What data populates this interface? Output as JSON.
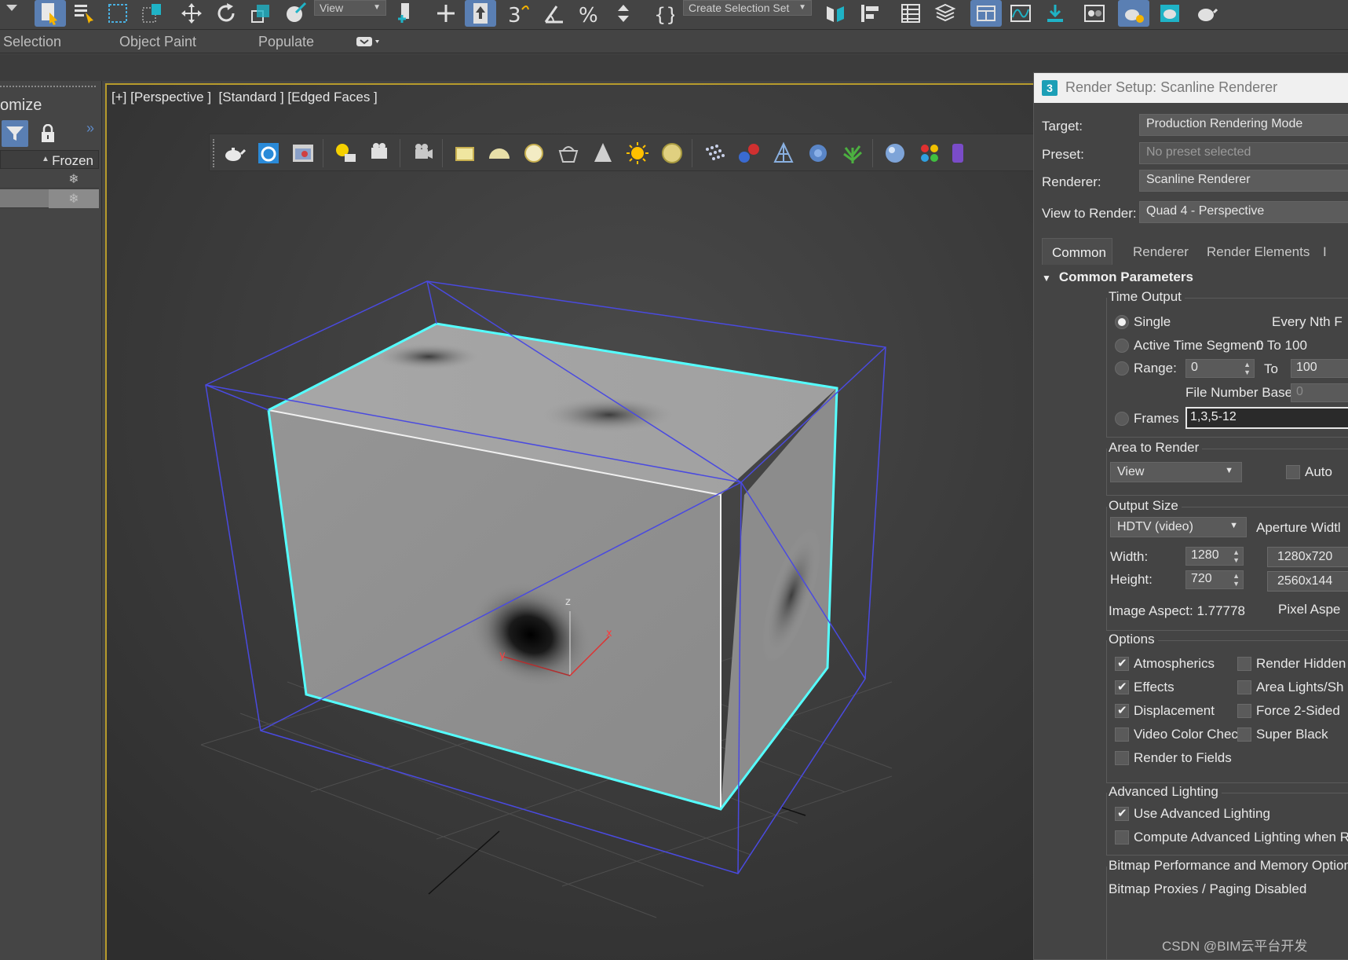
{
  "toolbar": {
    "view_dropdown": "View",
    "selection_set_dropdown": "Create Selection Set"
  },
  "ribbon": {
    "tabs": [
      "Selection",
      "Object Paint",
      "Populate"
    ]
  },
  "scene_explorer": {
    "title": "omize",
    "column_header": "Frozen"
  },
  "viewport": {
    "label": "[+] [Perspective ]  [Standard ] [Edged Faces ]",
    "gizmo": {
      "z": "z",
      "x": "x",
      "y": "y"
    }
  },
  "render_setup": {
    "title": "Render Setup: Scanline Renderer",
    "target_label": "Target:",
    "target_value": "Production Rendering Mode",
    "preset_label": "Preset:",
    "preset_value": "No preset selected",
    "renderer_label": "Renderer:",
    "renderer_value": "Scanline Renderer",
    "view_label": "View to Render:",
    "view_value": "Quad 4 - Perspective",
    "tabs": [
      "Common",
      "Renderer",
      "Render Elements",
      "I"
    ],
    "section": "Common Parameters",
    "time_output": {
      "title": "Time Output",
      "single": "Single",
      "every_nth": "Every Nth F",
      "active_segment": "Active Time Segment:",
      "active_segment_value": "0 To 100",
      "range": "Range:",
      "range_from": "0",
      "range_to_label": "To",
      "range_to": "100",
      "file_number_base": "File Number Base:",
      "file_number_base_value": "0",
      "frames": "Frames",
      "frames_value": "1,3,5-12"
    },
    "area_to_render": {
      "title": "Area to Render",
      "dropdown": "View",
      "auto": "Auto"
    },
    "output_size": {
      "title": "Output Size",
      "dropdown": "HDTV (video)",
      "aperture": "Aperture Widtl",
      "width_label": "Width:",
      "width_value": "1280",
      "height_label": "Height:",
      "height_value": "720",
      "preset_a": "1280x720",
      "preset_b": "2560x144",
      "image_aspect": "Image Aspect: 1.77778",
      "pixel_aspect": "Pixel Aspe"
    },
    "options": {
      "title": "Options",
      "left": [
        {
          "label": "Atmospherics",
          "checked": true
        },
        {
          "label": "Effects",
          "checked": true
        },
        {
          "label": "Displacement",
          "checked": true
        },
        {
          "label": "Video Color Check",
          "checked": false
        },
        {
          "label": "Render to Fields",
          "checked": false
        }
      ],
      "right": [
        {
          "label": "Render Hidden",
          "checked": false
        },
        {
          "label": "Area Lights/Sh",
          "checked": false
        },
        {
          "label": "Force 2-Sided",
          "checked": false
        },
        {
          "label": "Super Black",
          "checked": false
        }
      ]
    },
    "advanced_lighting": {
      "title": "Advanced Lighting",
      "use": "Use Advanced Lighting",
      "compute": "Compute Advanced Lighting when Req"
    },
    "bitmap_perf": "Bitmap Performance and Memory Options",
    "bitmap_proxies": "Bitmap Proxies / Paging Disabled"
  },
  "watermark": "CSDN @BIM云平台开发",
  "colors": {
    "accent_blue": "#5a7fb3",
    "selection_cyan": "#55ffff",
    "bbox_blue": "#4a4ae0",
    "viewport_border": "#b79b2c"
  }
}
